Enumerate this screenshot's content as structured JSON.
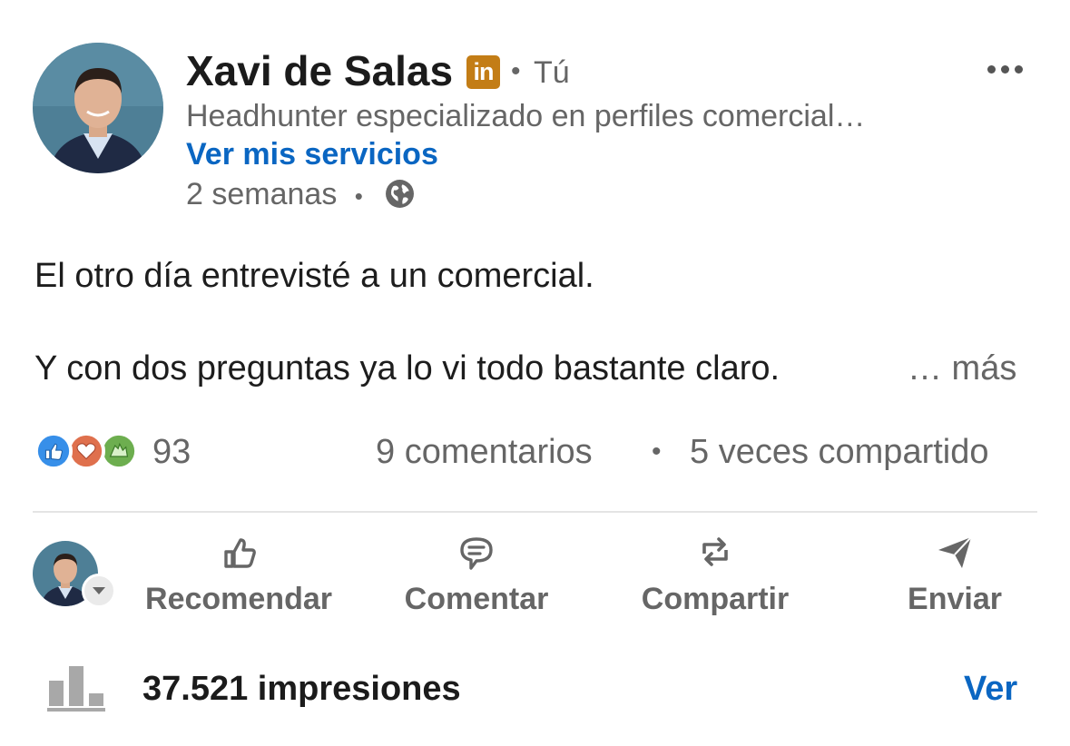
{
  "post": {
    "author": {
      "name": "Xavi de Salas",
      "badge_icon": "linkedin-icon",
      "badge_text": "in",
      "separator": "•",
      "relation": "Tú",
      "headline": "Headhunter especializado en perfiles comercial…",
      "services_link": "Ver mis servicios",
      "time": "2 semanas",
      "time_separator": "•",
      "visibility_icon": "globe-icon"
    },
    "more_options_icon": "ellipsis-icon",
    "body": {
      "line1": "El otro día entrevisté a un comercial.",
      "line2": "Y con dos preguntas ya lo vi todo bastante claro.",
      "see_more": "… más"
    },
    "social": {
      "reaction_icons": [
        "like-icon",
        "love-icon",
        "celebrate-icon"
      ],
      "reaction_count": "93",
      "comments": "9 comentarios",
      "separator": "•",
      "shares": "5 veces compartido"
    },
    "actions": {
      "recommend": "Recomendar",
      "comment": "Comentar",
      "share": "Compartir",
      "send": "Enviar"
    },
    "analytics": {
      "impressions": "37.521 impresiones",
      "view_link": "Ver"
    }
  },
  "colors": {
    "link_blue": "#0a66c2",
    "secondary_text": "#666666",
    "badge_gold": "#c37d16",
    "like_blue": "#378fe9",
    "love_red": "#df704d",
    "celebrate_green": "#6dae4f"
  }
}
